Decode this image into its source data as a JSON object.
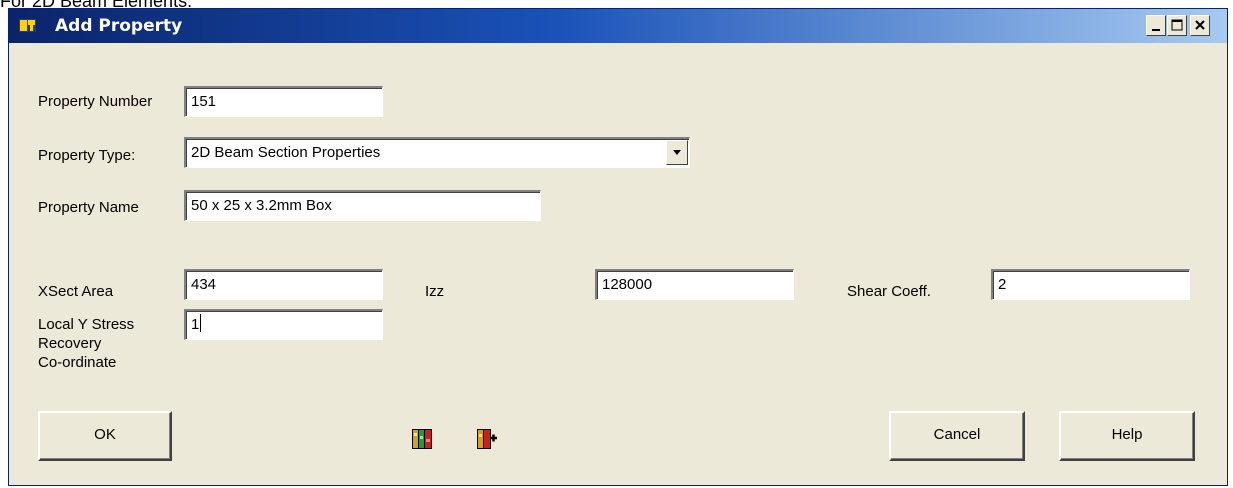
{
  "page_caption": "For 2D Beam Elements:",
  "window": {
    "title": "Add Property",
    "app_icon": "femap-icon",
    "controls": [
      "minimize-icon",
      "maximize-icon",
      "close-icon"
    ]
  },
  "form": {
    "property_number": {
      "label": "Property Number",
      "value": "151"
    },
    "property_type": {
      "label": "Property Type:",
      "value": "2D Beam Section Properties"
    },
    "property_name": {
      "label": "Property Name",
      "value": "50 x 25 x 3.2mm Box"
    },
    "xsect_area": {
      "label": "XSect Area",
      "value": "434"
    },
    "izz": {
      "label": "Izz",
      "value": "128000"
    },
    "shear_coeff": {
      "label": "Shear Coeff.",
      "value": "2"
    },
    "local_y_stress": {
      "label_lines": [
        "Local Y Stress",
        "Recovery",
        "Co-ordinate"
      ],
      "value": "1"
    }
  },
  "buttons": {
    "ok": "OK",
    "cancel": "Cancel",
    "help": "Help"
  },
  "toolbar_icons": [
    "section-library-icon",
    "add-to-library-icon"
  ],
  "colors": {
    "dialog_bg": "#ece9d8",
    "title_start": "#0a246a",
    "title_end": "#a6caf0"
  }
}
